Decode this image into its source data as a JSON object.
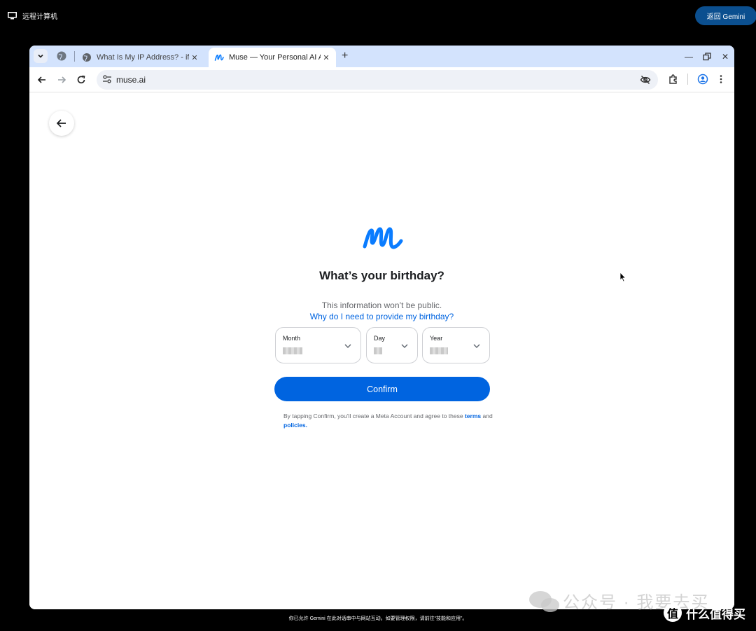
{
  "remote": {
    "title": "远程计算机",
    "back_button": "返回 Gemini",
    "footer_note": "你已允许 Gemini 在此对话串中与网站互动。如要管理权限，请前往“技能和应用”。"
  },
  "browser": {
    "tabs": [
      {
        "title": "What Is My IP Address? - ifc",
        "active": false,
        "favicon": "globe-icon"
      },
      {
        "title": "Muse — Your Personal AI Ap",
        "active": true,
        "favicon": "muse-logo-icon"
      }
    ],
    "url": "muse.ai"
  },
  "page": {
    "heading": "What’s your birthday?",
    "subtitle": "This information won’t be public.",
    "why_link": "Why do I need to provide my birthday?",
    "selects": [
      {
        "label": "Month",
        "value_hidden": true
      },
      {
        "label": "Day",
        "value_hidden": true
      },
      {
        "label": "Year",
        "value_hidden": true
      }
    ],
    "confirm_label": "Confirm",
    "terms": {
      "prefix": "By tapping Confirm, you’ll create a Meta Account and agree to these",
      "terms_link": "terms",
      "and": "and",
      "policies_link": "policies."
    }
  },
  "watermark": {
    "text": "公众号 · 我要去买",
    "brand_badge": "值",
    "brand_text": "什么值得买"
  },
  "colors": {
    "primary": "#0064e0",
    "tabstrip": "#d3e3fd",
    "remote_button": "#0b4f8f"
  }
}
